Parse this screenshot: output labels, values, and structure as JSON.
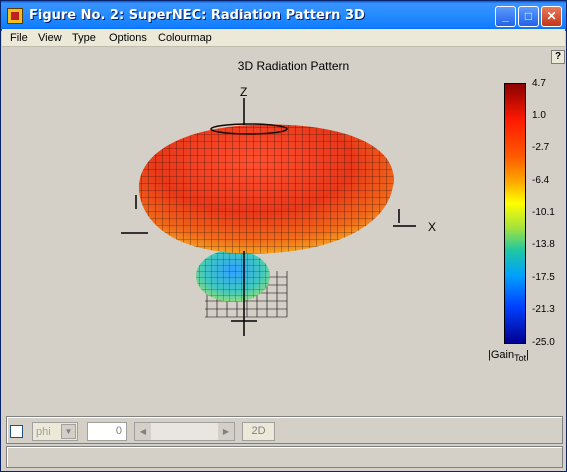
{
  "window": {
    "title": "Figure No. 2: SuperNEC: Radiation Pattern 3D",
    "controls": {
      "minimize": "_",
      "maximize": "□",
      "close": "✕"
    }
  },
  "menubar": {
    "items": [
      {
        "label": "File"
      },
      {
        "label": "View"
      },
      {
        "label": "Type"
      },
      {
        "label": "Options"
      },
      {
        "label": "Colourmap"
      }
    ]
  },
  "toolbar": {
    "help_label": "?"
  },
  "plot": {
    "title": "3D Radiation Pattern",
    "axis_labels": {
      "z": "Z",
      "x": "X"
    }
  },
  "colorbar": {
    "ticks": [
      "4.7",
      "1.0",
      "-2.7",
      "-6.4",
      "-10.1",
      "-13.8",
      "-17.5",
      "-21.3",
      "-25.0"
    ],
    "label_main": "|Gain",
    "label_sub": "Tot",
    "label_end": "|",
    "colors": [
      "#8b0000",
      "#ff1a00",
      "#ff5a00",
      "#ffaa00",
      "#ffff00",
      "#9fe040",
      "#20c8a0",
      "#00a0ff",
      "#0040ff",
      "#000090"
    ]
  },
  "controls": {
    "checkbox_checked": false,
    "angle_select": {
      "value": "phi"
    },
    "angle_value": "0",
    "button_2d": "2D"
  }
}
